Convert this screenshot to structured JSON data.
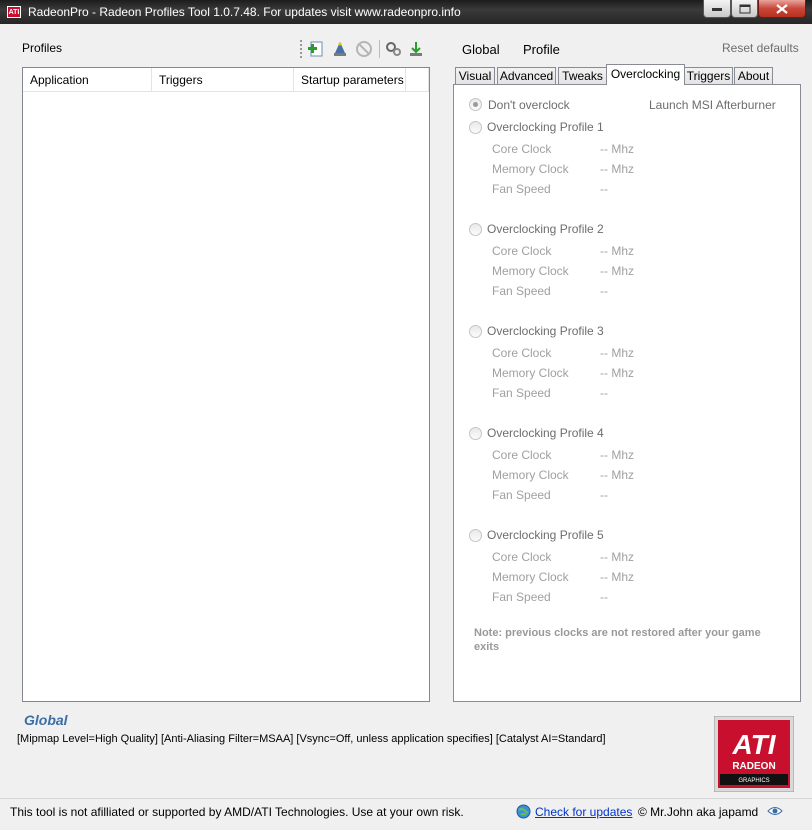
{
  "window": {
    "title": "RadeonPro - Radeon Profiles Tool 1.0.7.48. For updates visit www.radeonpro.info",
    "app_icon_text": "ATI"
  },
  "profiles": {
    "label": "Profiles",
    "toolbar_icons": [
      "add-profile-icon",
      "wizard-icon",
      "disabled-icon",
      "settings-icon",
      "download-icon"
    ],
    "columns": [
      "Application",
      "Triggers",
      "Startup parameters"
    ]
  },
  "mode": {
    "global": "Global",
    "profile": "Profile",
    "reset": "Reset defaults"
  },
  "tabs": [
    "Visual",
    "Advanced",
    "Tweaks",
    "Overclocking",
    "Triggers",
    "About"
  ],
  "active_tab": "Overclocking",
  "overclocking": {
    "dont_overclock": "Don't overclock",
    "launch_afterburner": "Launch MSI Afterburner",
    "profiles": [
      {
        "name": "Overclocking Profile 1",
        "core_label": "Core Clock",
        "core_value": "-- Mhz",
        "mem_label": "Memory Clock",
        "mem_value": "-- Mhz",
        "fan_label": "Fan Speed",
        "fan_value": "--"
      },
      {
        "name": "Overclocking Profile 2",
        "core_label": "Core Clock",
        "core_value": "-- Mhz",
        "mem_label": "Memory Clock",
        "mem_value": "-- Mhz",
        "fan_label": "Fan Speed",
        "fan_value": "--"
      },
      {
        "name": "Overclocking Profile 3",
        "core_label": "Core Clock",
        "core_value": "-- Mhz",
        "mem_label": "Memory Clock",
        "mem_value": "-- Mhz",
        "fan_label": "Fan Speed",
        "fan_value": "--"
      },
      {
        "name": "Overclocking Profile 4",
        "core_label": "Core Clock",
        "core_value": "-- Mhz",
        "mem_label": "Memory Clock",
        "mem_value": "-- Mhz",
        "fan_label": "Fan Speed",
        "fan_value": "--"
      },
      {
        "name": "Overclocking Profile 5",
        "core_label": "Core Clock",
        "core_value": "-- Mhz",
        "mem_label": "Memory Clock",
        "mem_value": "-- Mhz",
        "fan_label": "Fan Speed",
        "fan_value": "--"
      }
    ],
    "note": "Note: previous clocks are not restored after your game exits"
  },
  "global_section": {
    "title": "Global",
    "description": "[Mipmap Level=High Quality] [Anti-Aliasing Filter=MSAA] [Vsync=Off, unless application specifies] [Catalyst AI=Standard]"
  },
  "logo": {
    "brand": "ATI",
    "product": "RADEON",
    "sub": "GRAPHICS",
    "color": "#c8102e"
  },
  "status": {
    "disclaimer": "This tool is not afilliated or supported by AMD/ATI Technologies. Use at your own risk.",
    "check_updates": "Check for updates",
    "credit": "© Mr.John aka japamd"
  }
}
